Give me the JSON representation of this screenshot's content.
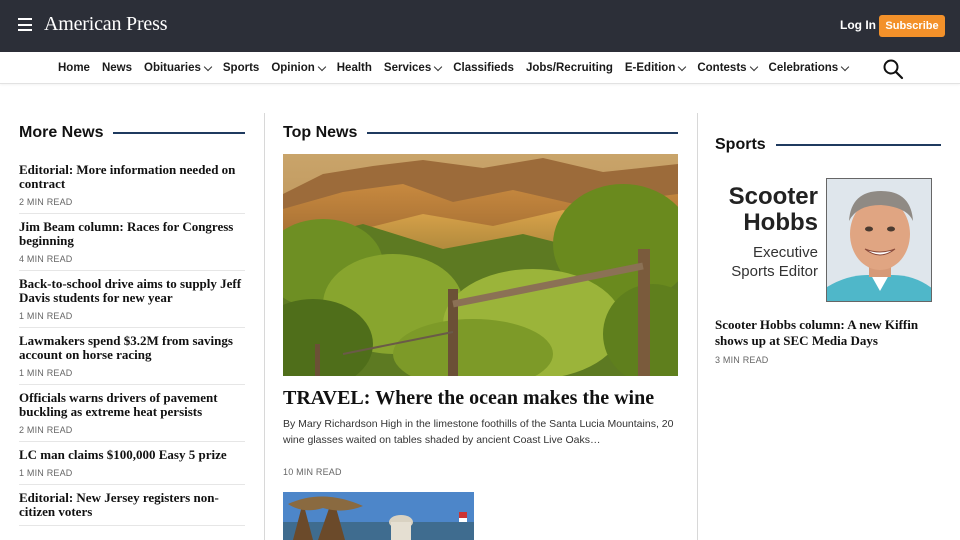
{
  "header": {
    "logo": "American Press",
    "login_label": "Log In",
    "subscribe_label": "Subscribe",
    "bg_color": "#2c2f38",
    "accent_color": "#f3912a"
  },
  "nav": {
    "items": [
      {
        "label": "Home",
        "dropdown": false
      },
      {
        "label": "News",
        "dropdown": false
      },
      {
        "label": "Obituaries",
        "dropdown": true
      },
      {
        "label": "Sports",
        "dropdown": false
      },
      {
        "label": "Opinion",
        "dropdown": true
      },
      {
        "label": "Health",
        "dropdown": false
      },
      {
        "label": "Services",
        "dropdown": true
      },
      {
        "label": "Classifieds",
        "dropdown": false
      },
      {
        "label": "Jobs/Recruiting",
        "dropdown": false
      },
      {
        "label": "E-Edition",
        "dropdown": true
      },
      {
        "label": "Contests",
        "dropdown": true
      },
      {
        "label": "Celebrations",
        "dropdown": true
      }
    ],
    "search_icon": "search-icon"
  },
  "more_news": {
    "heading": "More News",
    "items": [
      {
        "title": "Editorial: More information needed on contract",
        "meta": "2 MIN READ"
      },
      {
        "title": "Jim Beam column: Races for Congress beginning",
        "meta": "4 MIN READ"
      },
      {
        "title": "Back-to-school drive aims to supply Jeff Davis students for new year",
        "meta": "1 MIN READ"
      },
      {
        "title": "Lawmakers spend $3.2M from savings account on horse racing",
        "meta": "1 MIN READ"
      },
      {
        "title": "Officials warns drivers of pavement buckling as extreme heat persists",
        "meta": "2 MIN READ"
      },
      {
        "title": "LC man claims $100,000 Easy 5 prize",
        "meta": "1 MIN READ"
      },
      {
        "title": "Editorial: New Jersey registers non-citizen voters",
        "meta": ""
      }
    ]
  },
  "top_news": {
    "heading": "Top News",
    "lead": {
      "title": "TRAVEL: Where the ocean makes the wine",
      "summary": "By Mary Richardson High in the limestone foothills of the Santa Lucia Mountains, 20 wine glasses waited on tables shaded by ancient Coast Live Oaks…",
      "meta": "10 MIN READ"
    }
  },
  "sports": {
    "heading": "Sports",
    "card": {
      "name_line1": "Scooter",
      "name_line2": "Hobbs",
      "role_line1": "Executive",
      "role_line2": "Sports Editor"
    },
    "article": {
      "title": "Scooter Hobbs column: A new Kiffin shows up at SEC Media Days",
      "meta": "3 MIN READ"
    }
  }
}
